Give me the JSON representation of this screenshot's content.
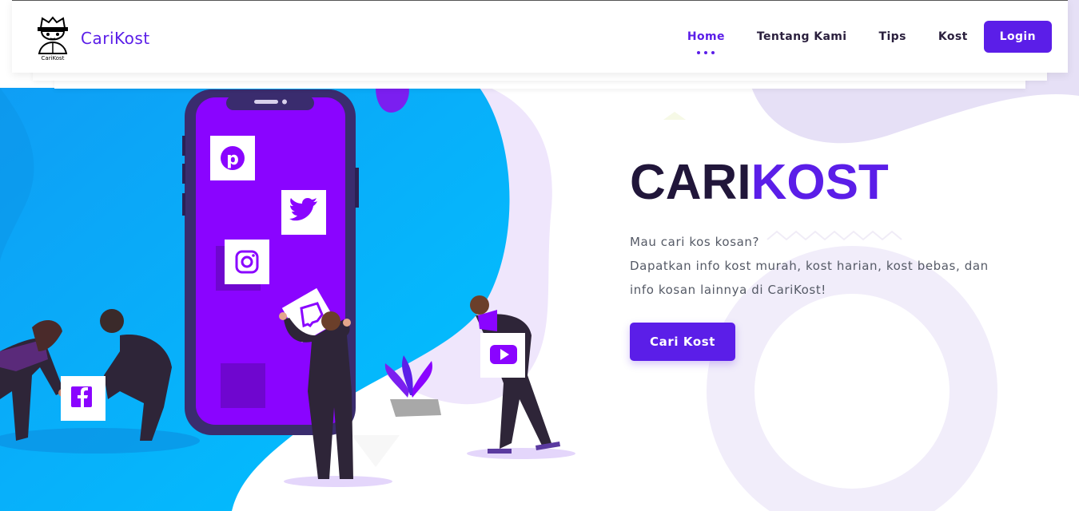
{
  "brand": {
    "name": "CariKost",
    "logo_caption": "CariKost",
    "color": "#5b1ee8"
  },
  "nav": {
    "items": [
      {
        "label": "Home",
        "active": true
      },
      {
        "label": "Tentang Kami",
        "active": false
      },
      {
        "label": "Tips",
        "active": false
      },
      {
        "label": "Kost",
        "active": false
      }
    ],
    "login_label": "Login"
  },
  "hero": {
    "title_plain": "CARI",
    "title_accent": "KOST",
    "line1": "Mau cari kos kosan?",
    "line2": "Dapatkan info kost murah, kost harian, kost bebas, dan",
    "line3": "info kosan lainnya di CariKost!",
    "cta_label": "Cari Kost"
  },
  "illustration": {
    "icons": [
      "pinterest-icon",
      "twitter-icon",
      "instagram-icon",
      "twitch-icon",
      "facebook-icon",
      "youtube-icon"
    ]
  },
  "colors": {
    "accent": "#5b1ee8",
    "blob_blue": "#0aa8f5",
    "phone_screen": "#8a04ff",
    "lavender": "#ede7fb",
    "text_dark": "#21163a"
  }
}
